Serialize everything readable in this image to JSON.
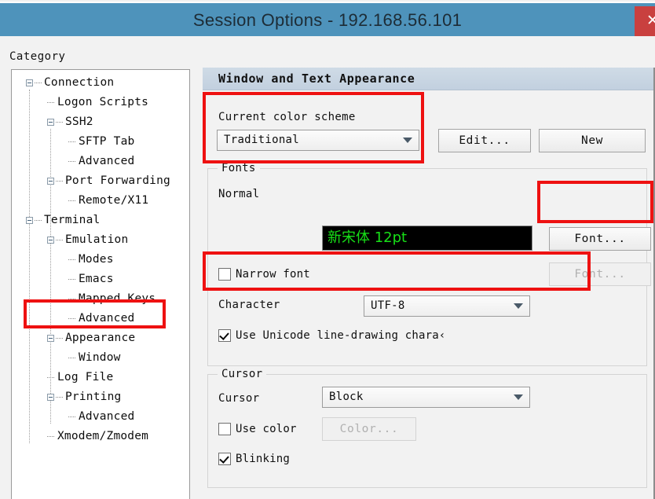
{
  "window": {
    "title": "Session Options - 192.168.56.101",
    "close_label": "✕"
  },
  "sidebar": {
    "heading": "Category",
    "items": [
      {
        "label": "Connection",
        "indent": 0,
        "expander": true
      },
      {
        "label": "Logon Scripts",
        "indent": 1,
        "expander": false
      },
      {
        "label": "SSH2",
        "indent": 1,
        "expander": true
      },
      {
        "label": "SFTP Tab",
        "indent": 2,
        "expander": false
      },
      {
        "label": "Advanced",
        "indent": 2,
        "expander": false
      },
      {
        "label": "Port Forwarding",
        "indent": 1,
        "expander": true
      },
      {
        "label": "Remote/X11",
        "indent": 2,
        "expander": false
      },
      {
        "label": "Terminal",
        "indent": 0,
        "expander": true
      },
      {
        "label": "Emulation",
        "indent": 1,
        "expander": true
      },
      {
        "label": "Modes",
        "indent": 2,
        "expander": false
      },
      {
        "label": "Emacs",
        "indent": 2,
        "expander": false
      },
      {
        "label": "Mapped Keys",
        "indent": 2,
        "expander": false
      },
      {
        "label": "Advanced",
        "indent": 2,
        "expander": false
      },
      {
        "label": "Appearance",
        "indent": 1,
        "expander": true
      },
      {
        "label": "Window",
        "indent": 2,
        "expander": false
      },
      {
        "label": "Log File",
        "indent": 1,
        "expander": false
      },
      {
        "label": "Printing",
        "indent": 1,
        "expander": true
      },
      {
        "label": "Advanced",
        "indent": 2,
        "expander": false
      },
      {
        "label": "Xmodem/Zmodem",
        "indent": 1,
        "expander": false
      }
    ],
    "selected": "Appearance"
  },
  "pane": {
    "header": "Window and Text Appearance",
    "color_scheme": {
      "label": "Current color scheme",
      "value": "Traditional",
      "edit_button": "Edit...",
      "new_button": "New"
    },
    "fonts": {
      "group_title": "Fonts",
      "normal_label": "Normal",
      "normal_sample": "新宋体 12pt",
      "normal_font_button": "Font...",
      "narrow_font_label": "Narrow font",
      "narrow_font_checked": false,
      "narrow_font_button": "Font...",
      "character_label": "Character",
      "character_value": "UTF-8",
      "unicode_line_drawing_label": "Use Unicode line-drawing chara‹",
      "unicode_line_drawing_checked": true
    },
    "cursor": {
      "group_title": "Cursor",
      "cursor_label": "Cursor",
      "cursor_value": "Block",
      "use_color_label": "Use color",
      "use_color_checked": false,
      "color_button": "Color...",
      "blinking_label": "Blinking",
      "blinking_checked": true
    }
  },
  "colors": {
    "titlebar": "#4e93bb",
    "close_button": "#c9403f",
    "pane_header": "#c6d4e1",
    "annotation": "#ee1111",
    "sample_text": "#17e017",
    "sample_background": "#000000"
  }
}
